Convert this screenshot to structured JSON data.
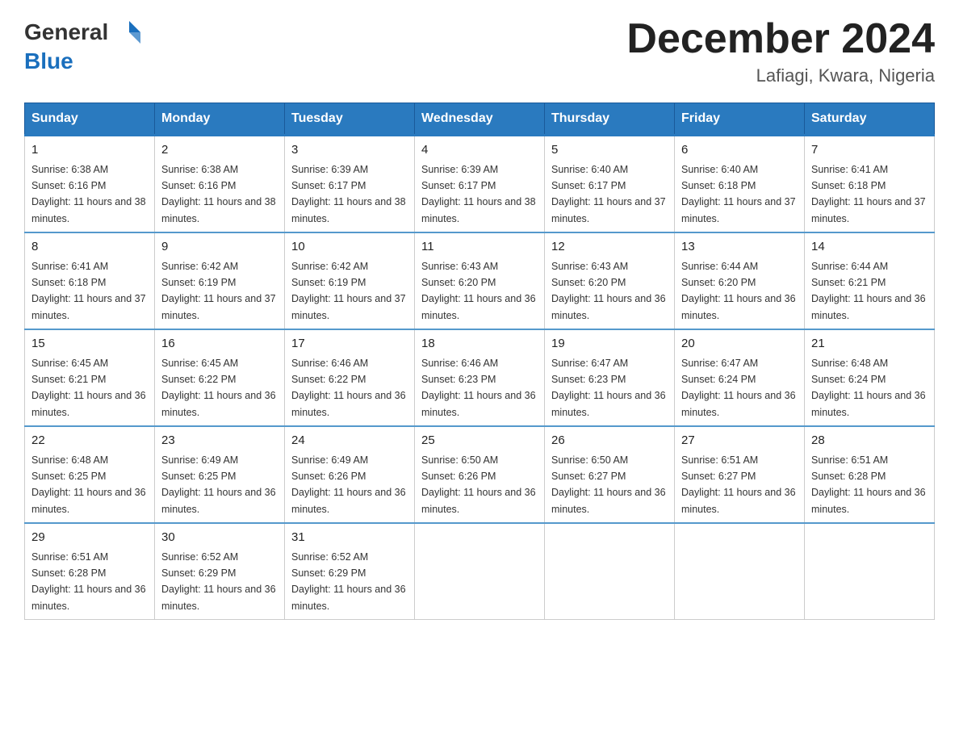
{
  "header": {
    "logo_text1": "General",
    "logo_text2": "Blue",
    "title": "December 2024",
    "subtitle": "Lafiagi, Kwara, Nigeria"
  },
  "weekdays": [
    "Sunday",
    "Monday",
    "Tuesday",
    "Wednesday",
    "Thursday",
    "Friday",
    "Saturday"
  ],
  "weeks": [
    [
      {
        "day": "1",
        "sunrise": "6:38 AM",
        "sunset": "6:16 PM",
        "daylight": "11 hours and 38 minutes."
      },
      {
        "day": "2",
        "sunrise": "6:38 AM",
        "sunset": "6:16 PM",
        "daylight": "11 hours and 38 minutes."
      },
      {
        "day": "3",
        "sunrise": "6:39 AM",
        "sunset": "6:17 PM",
        "daylight": "11 hours and 38 minutes."
      },
      {
        "day": "4",
        "sunrise": "6:39 AM",
        "sunset": "6:17 PM",
        "daylight": "11 hours and 38 minutes."
      },
      {
        "day": "5",
        "sunrise": "6:40 AM",
        "sunset": "6:17 PM",
        "daylight": "11 hours and 37 minutes."
      },
      {
        "day": "6",
        "sunrise": "6:40 AM",
        "sunset": "6:18 PM",
        "daylight": "11 hours and 37 minutes."
      },
      {
        "day": "7",
        "sunrise": "6:41 AM",
        "sunset": "6:18 PM",
        "daylight": "11 hours and 37 minutes."
      }
    ],
    [
      {
        "day": "8",
        "sunrise": "6:41 AM",
        "sunset": "6:18 PM",
        "daylight": "11 hours and 37 minutes."
      },
      {
        "day": "9",
        "sunrise": "6:42 AM",
        "sunset": "6:19 PM",
        "daylight": "11 hours and 37 minutes."
      },
      {
        "day": "10",
        "sunrise": "6:42 AM",
        "sunset": "6:19 PM",
        "daylight": "11 hours and 37 minutes."
      },
      {
        "day": "11",
        "sunrise": "6:43 AM",
        "sunset": "6:20 PM",
        "daylight": "11 hours and 36 minutes."
      },
      {
        "day": "12",
        "sunrise": "6:43 AM",
        "sunset": "6:20 PM",
        "daylight": "11 hours and 36 minutes."
      },
      {
        "day": "13",
        "sunrise": "6:44 AM",
        "sunset": "6:20 PM",
        "daylight": "11 hours and 36 minutes."
      },
      {
        "day": "14",
        "sunrise": "6:44 AM",
        "sunset": "6:21 PM",
        "daylight": "11 hours and 36 minutes."
      }
    ],
    [
      {
        "day": "15",
        "sunrise": "6:45 AM",
        "sunset": "6:21 PM",
        "daylight": "11 hours and 36 minutes."
      },
      {
        "day": "16",
        "sunrise": "6:45 AM",
        "sunset": "6:22 PM",
        "daylight": "11 hours and 36 minutes."
      },
      {
        "day": "17",
        "sunrise": "6:46 AM",
        "sunset": "6:22 PM",
        "daylight": "11 hours and 36 minutes."
      },
      {
        "day": "18",
        "sunrise": "6:46 AM",
        "sunset": "6:23 PM",
        "daylight": "11 hours and 36 minutes."
      },
      {
        "day": "19",
        "sunrise": "6:47 AM",
        "sunset": "6:23 PM",
        "daylight": "11 hours and 36 minutes."
      },
      {
        "day": "20",
        "sunrise": "6:47 AM",
        "sunset": "6:24 PM",
        "daylight": "11 hours and 36 minutes."
      },
      {
        "day": "21",
        "sunrise": "6:48 AM",
        "sunset": "6:24 PM",
        "daylight": "11 hours and 36 minutes."
      }
    ],
    [
      {
        "day": "22",
        "sunrise": "6:48 AM",
        "sunset": "6:25 PM",
        "daylight": "11 hours and 36 minutes."
      },
      {
        "day": "23",
        "sunrise": "6:49 AM",
        "sunset": "6:25 PM",
        "daylight": "11 hours and 36 minutes."
      },
      {
        "day": "24",
        "sunrise": "6:49 AM",
        "sunset": "6:26 PM",
        "daylight": "11 hours and 36 minutes."
      },
      {
        "day": "25",
        "sunrise": "6:50 AM",
        "sunset": "6:26 PM",
        "daylight": "11 hours and 36 minutes."
      },
      {
        "day": "26",
        "sunrise": "6:50 AM",
        "sunset": "6:27 PM",
        "daylight": "11 hours and 36 minutes."
      },
      {
        "day": "27",
        "sunrise": "6:51 AM",
        "sunset": "6:27 PM",
        "daylight": "11 hours and 36 minutes."
      },
      {
        "day": "28",
        "sunrise": "6:51 AM",
        "sunset": "6:28 PM",
        "daylight": "11 hours and 36 minutes."
      }
    ],
    [
      {
        "day": "29",
        "sunrise": "6:51 AM",
        "sunset": "6:28 PM",
        "daylight": "11 hours and 36 minutes."
      },
      {
        "day": "30",
        "sunrise": "6:52 AM",
        "sunset": "6:29 PM",
        "daylight": "11 hours and 36 minutes."
      },
      {
        "day": "31",
        "sunrise": "6:52 AM",
        "sunset": "6:29 PM",
        "daylight": "11 hours and 36 minutes."
      },
      null,
      null,
      null,
      null
    ]
  ]
}
